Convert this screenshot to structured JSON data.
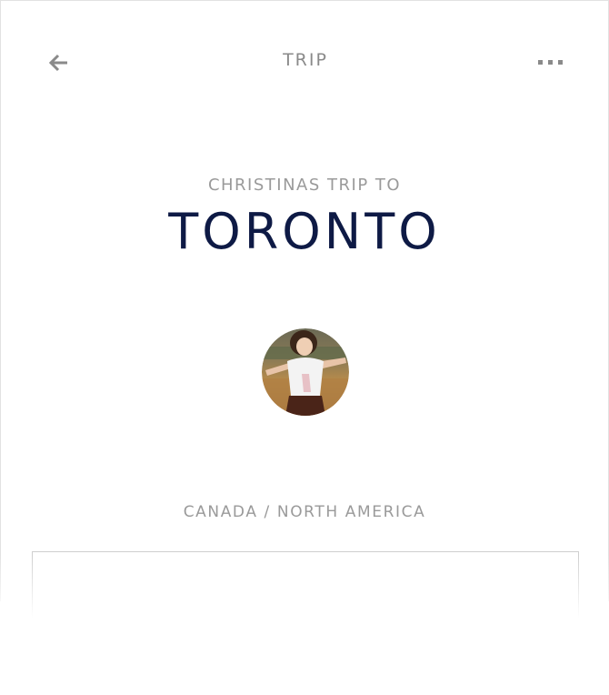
{
  "header": {
    "title": "TRIP",
    "back_icon": "arrow-left-icon",
    "more_icon": "more-horizontal-icon"
  },
  "trip": {
    "subtitle": "CHRISTINAS TRIP TO",
    "city": "TORONTO",
    "location": "CANADA / NORTH AMERICA"
  },
  "colors": {
    "title_navy": "#0e1a45",
    "muted_gray": "#9a9a9a",
    "icon_gray": "#8a8a8a"
  }
}
